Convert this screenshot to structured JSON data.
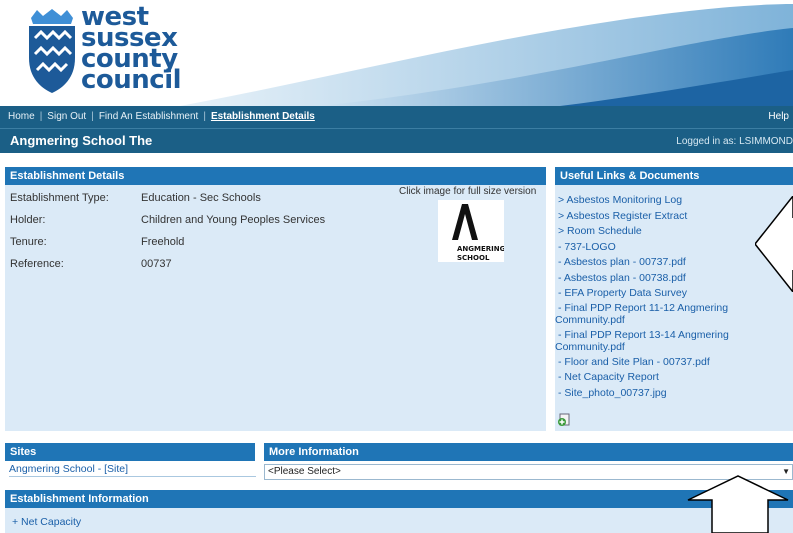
{
  "logo": {
    "lines": [
      "west",
      "sussex",
      "county",
      "council"
    ]
  },
  "nav": {
    "links": [
      "Home",
      "Sign Out",
      "Find An Establishment",
      "Establishment Details"
    ],
    "help": "Help"
  },
  "titlebar": {
    "establishment_name": "Angmering School The",
    "logged_in": "Logged in as: LSIMMOND"
  },
  "establishment_details": {
    "heading": "Establishment Details",
    "rows": [
      {
        "label": "Establishment Type:",
        "value": "Education - Sec Schools"
      },
      {
        "label": "Holder:",
        "value": "Children and Young Peoples Services"
      },
      {
        "label": "Tenure:",
        "value": "Freehold"
      },
      {
        "label": "Reference:",
        "value": "00737"
      }
    ],
    "image_note": "Click image for full size version",
    "school_logo_text": [
      "ANGMERING",
      "SCHOOL"
    ]
  },
  "useful_links": {
    "heading": "Useful Links & Documents",
    "items": [
      "> Asbestos Monitoring Log",
      "> Asbestos Register Extract",
      "> Room Schedule",
      "- 737-LOGO",
      "- Asbestos plan - 00737.pdf",
      "- Asbestos plan - 00738.pdf",
      "- EFA Property Data Survey",
      "- Final PDP Report 11-12 Angmering",
      "Community.pdf",
      "- Final PDP Report 13-14 Angmering",
      "Community.pdf",
      "- Floor and Site Plan - 00737.pdf",
      "- Net Capacity Report",
      "- Site_photo_00737.jpg"
    ]
  },
  "sites": {
    "heading": "Sites",
    "items": [
      "Angmering School - [Site]"
    ]
  },
  "more_information": {
    "heading": "More Information",
    "selected": "<Please Select>"
  },
  "establishment_information": {
    "heading": "Establishment Information",
    "items": [
      "+ Net Capacity"
    ]
  },
  "colors": {
    "nav_bg": "#1b5f86",
    "panel_head": "#1f75b6",
    "panel_body": "#dbeaf7",
    "link": "#1a5fa8",
    "logo_blue": "#1d5a99"
  }
}
